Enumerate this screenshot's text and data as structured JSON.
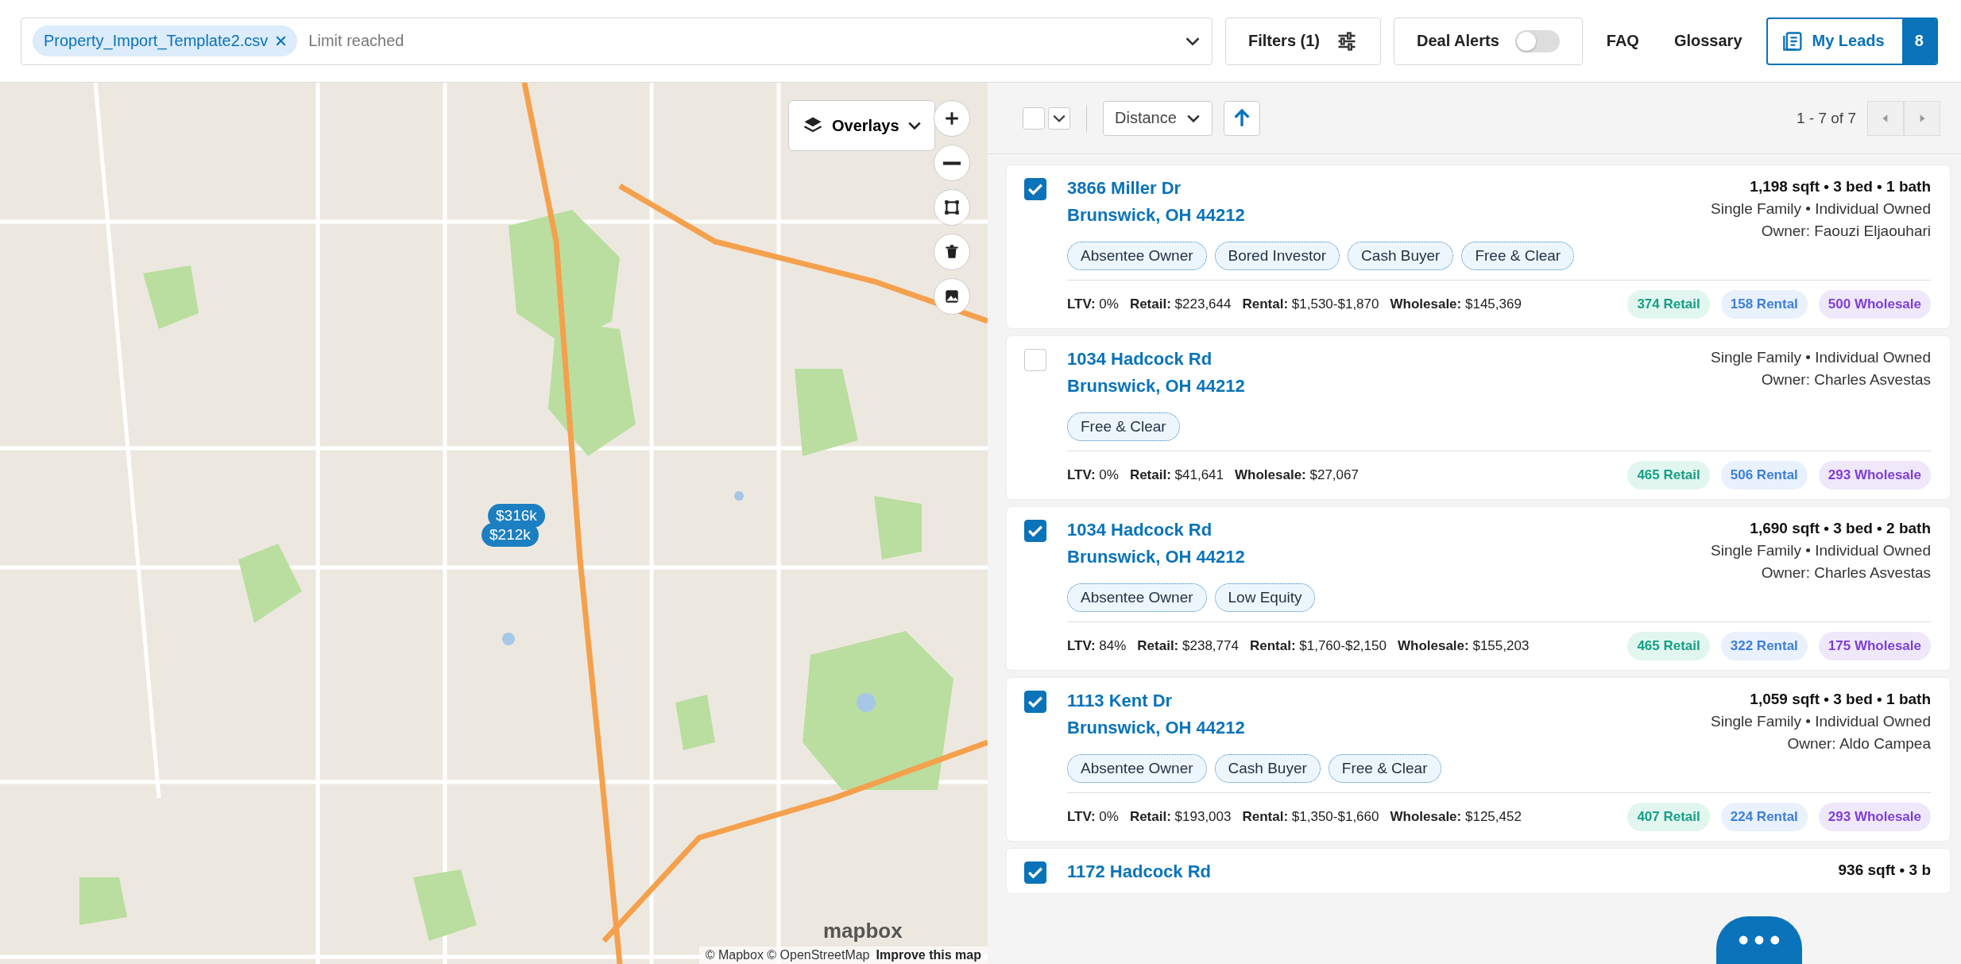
{
  "search": {
    "chip": "Property_Import_Template2.csv",
    "placeholder": "Limit reached"
  },
  "toolbar": {
    "filters": "Filters (1)",
    "deal_alerts": {
      "label": "Deal Alerts",
      "on": false
    },
    "faq": "FAQ",
    "glossary": "Glossary",
    "my_leads": {
      "label": "My Leads",
      "count": "8"
    }
  },
  "map": {
    "overlays": "Overlays",
    "markers": [
      {
        "label": "$316k"
      },
      {
        "label": "$212k"
      }
    ],
    "logo": "mapbox",
    "attribution": "© Mapbox © OpenStreetMap",
    "improve": "Improve this map"
  },
  "list_header": {
    "select_all": {
      "checked": false
    },
    "sort": "Distance",
    "pagination": "1 - 7 of 7"
  },
  "leads": [
    {
      "checked": true,
      "address": "3866 Miller Dr",
      "city": "Brunswick, OH 44212",
      "stats": "1,198 sqft • 3 bed • 1 bath",
      "type": "Single Family • Individual Owned",
      "owner": "Owner: Faouzi Eljaouhari",
      "tags": [
        "Absentee Owner",
        "Bored Investor",
        "Cash Buyer",
        "Free & Clear"
      ],
      "metrics": [
        {
          "label": "LTV:",
          "value": "0%"
        },
        {
          "label": "Retail:",
          "value": "$223,644"
        },
        {
          "label": "Rental:",
          "value": "$1,530-$1,870"
        },
        {
          "label": "Wholesale:",
          "value": "$145,369"
        }
      ],
      "comps": [
        {
          "kind": "retail",
          "label": "374 Retail"
        },
        {
          "kind": "rental",
          "label": "158 Rental"
        },
        {
          "kind": "wholesale",
          "label": "500 Wholesale"
        }
      ]
    },
    {
      "checked": false,
      "address": "1034 Hadcock Rd",
      "city": "Brunswick, OH 44212",
      "type": "Single Family • Individual Owned",
      "owner": "Owner: Charles Asvestas",
      "tags": [
        "Free & Clear"
      ],
      "metrics": [
        {
          "label": "LTV:",
          "value": "0%"
        },
        {
          "label": "Retail:",
          "value": "$41,641"
        },
        {
          "label": "Wholesale:",
          "value": "$27,067"
        }
      ],
      "comps": [
        {
          "kind": "retail",
          "label": "465 Retail"
        },
        {
          "kind": "rental",
          "label": "506 Rental"
        },
        {
          "kind": "wholesale",
          "label": "293 Wholesale"
        }
      ]
    },
    {
      "checked": true,
      "address": "1034 Hadcock Rd",
      "city": "Brunswick, OH 44212",
      "stats": "1,690 sqft • 3 bed • 2 bath",
      "type": "Single Family • Individual Owned",
      "owner": "Owner: Charles Asvestas",
      "tags": [
        "Absentee Owner",
        "Low Equity"
      ],
      "metrics": [
        {
          "label": "LTV:",
          "value": "84%"
        },
        {
          "label": "Retail:",
          "value": "$238,774"
        },
        {
          "label": "Rental:",
          "value": "$1,760-$2,150"
        },
        {
          "label": "Wholesale:",
          "value": "$155,203"
        }
      ],
      "comps": [
        {
          "kind": "retail",
          "label": "465 Retail"
        },
        {
          "kind": "rental",
          "label": "322 Rental"
        },
        {
          "kind": "wholesale",
          "label": "175 Wholesale"
        }
      ]
    },
    {
      "checked": true,
      "address": "1113 Kent Dr",
      "city": "Brunswick, OH 44212",
      "stats": "1,059 sqft • 3 bed • 1 bath",
      "type": "Single Family • Individual Owned",
      "owner": "Owner: Aldo Campea",
      "tags": [
        "Absentee Owner",
        "Cash Buyer",
        "Free & Clear"
      ],
      "metrics": [
        {
          "label": "LTV:",
          "value": "0%"
        },
        {
          "label": "Retail:",
          "value": "$193,003"
        },
        {
          "label": "Rental:",
          "value": "$1,350-$1,660"
        },
        {
          "label": "Wholesale:",
          "value": "$125,452"
        }
      ],
      "comps": [
        {
          "kind": "retail",
          "label": "407 Retail"
        },
        {
          "kind": "rental",
          "label": "224 Rental"
        },
        {
          "kind": "wholesale",
          "label": "293 Wholesale"
        }
      ]
    },
    {
      "checked": true,
      "address": "1172 Hadcock Rd",
      "stats": "936 sqft • 3 b"
    }
  ]
}
